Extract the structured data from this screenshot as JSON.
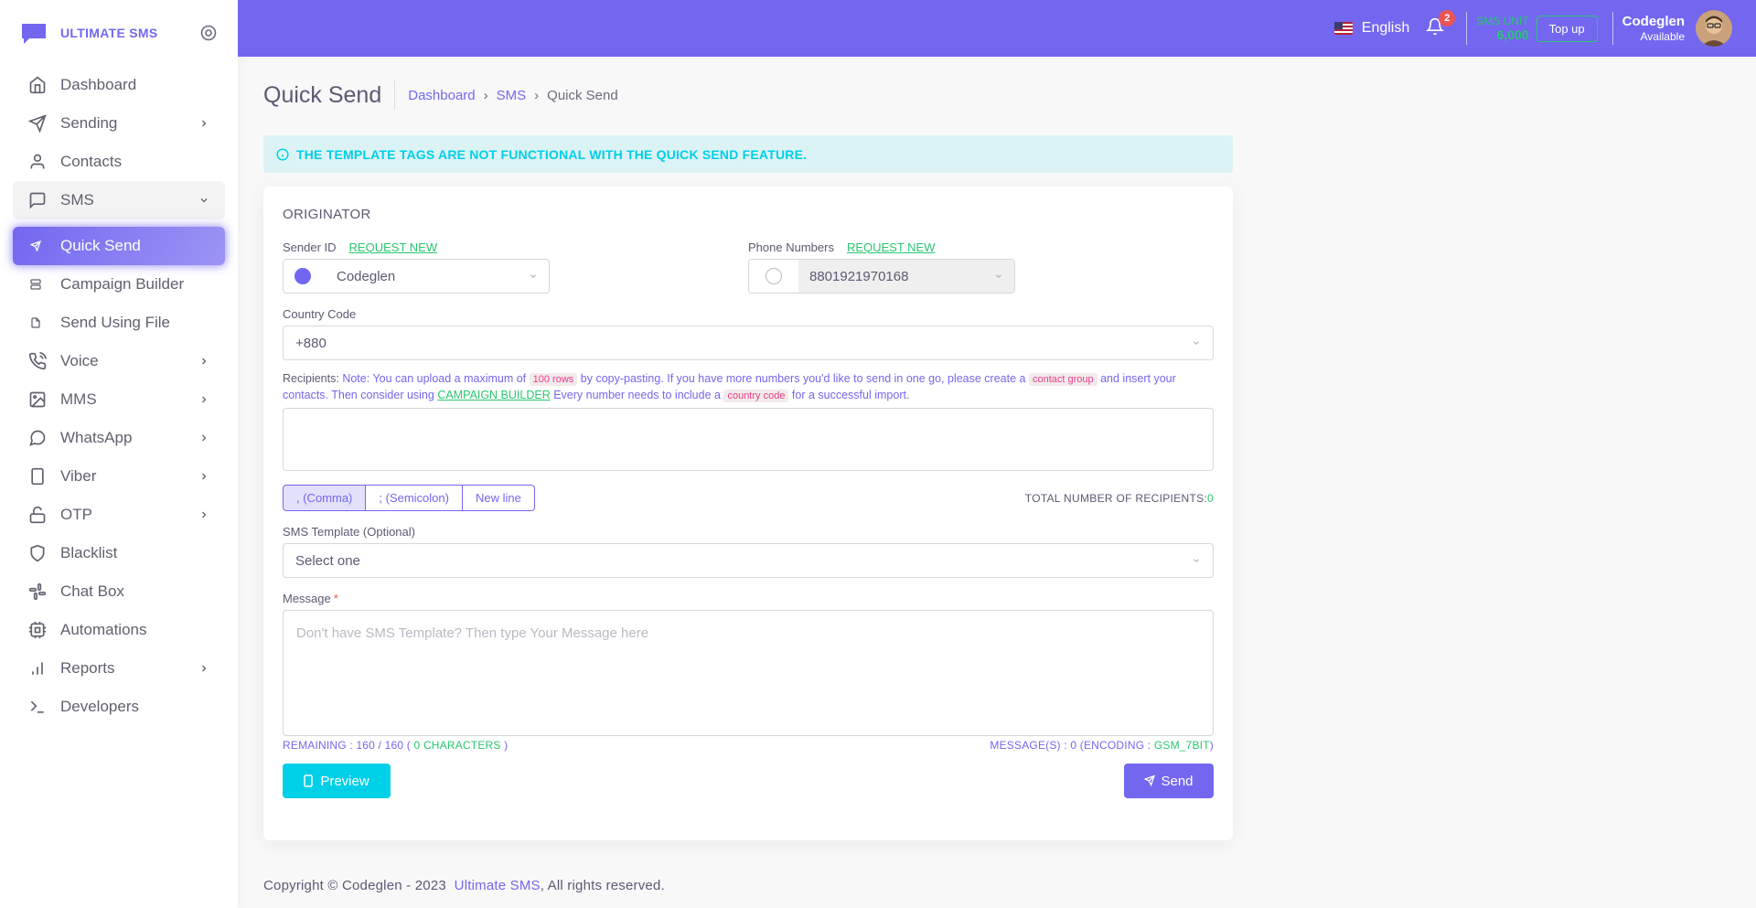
{
  "brand": {
    "name": "ULTIMATE SMS"
  },
  "sidebar": {
    "items": [
      {
        "label": "Dashboard",
        "icon": "home-icon"
      },
      {
        "label": "Sending",
        "icon": "send-icon",
        "has_children": true
      },
      {
        "label": "Contacts",
        "icon": "user-icon"
      },
      {
        "label": "SMS",
        "icon": "message-square-icon",
        "expanded": true
      },
      {
        "label": "Quick Send",
        "icon": "send-small-icon",
        "active": true
      },
      {
        "label": "Campaign Builder",
        "icon": "server-icon"
      },
      {
        "label": "Send Using File",
        "icon": "file-icon"
      },
      {
        "label": "Voice",
        "icon": "phone-call-icon",
        "has_children": true
      },
      {
        "label": "MMS",
        "icon": "image-icon",
        "has_children": true
      },
      {
        "label": "WhatsApp",
        "icon": "message-circle-icon",
        "has_children": true
      },
      {
        "label": "Viber",
        "icon": "smartphone-icon",
        "has_children": true
      },
      {
        "label": "OTP",
        "icon": "unlock-icon",
        "has_children": true
      },
      {
        "label": "Blacklist",
        "icon": "shield-icon"
      },
      {
        "label": "Chat Box",
        "icon": "slack-icon"
      },
      {
        "label": "Automations",
        "icon": "cpu-icon"
      },
      {
        "label": "Reports",
        "icon": "bar-chart-icon",
        "has_children": true
      },
      {
        "label": "Developers",
        "icon": "terminal-icon"
      }
    ]
  },
  "header": {
    "language": "English",
    "notification_count": "2",
    "sms_unit_label": "SMS UNIT",
    "sms_unit_value": "6,000",
    "topup_label": "Top up",
    "user_name": "Codeglen",
    "user_status": "Available"
  },
  "page": {
    "title": "Quick Send",
    "breadcrumb": [
      "Dashboard",
      "SMS",
      "Quick Send"
    ],
    "alert": "THE TEMPLATE TAGS ARE NOT FUNCTIONAL WITH THE QUICK SEND FEATURE."
  },
  "form": {
    "section_title": "ORIGINATOR",
    "sender_id_label": "Sender ID",
    "request_new": "REQUEST NEW",
    "sender_id_value": "Codeglen",
    "phone_numbers_label": "Phone Numbers",
    "phone_number_value": "8801921970168",
    "country_code_label": "Country Code",
    "country_code_value": "+880",
    "recipients_label": "Recipients:",
    "note_1": "Note: You can upload a maximum of",
    "note_rows": "100 rows",
    "note_2": "by copy-pasting. If you have more numbers you'd like to send in one go, please create a",
    "note_group": "contact group",
    "note_3": "and insert your contacts. Then consider using",
    "note_link": "CAMPAIGN BUILDER",
    "note_4": "Every number needs to include a",
    "note_cc": "country code",
    "note_5": "for a successful import.",
    "delimiters": [
      ", (Comma)",
      "; (Semicolon)",
      "New line"
    ],
    "total_recipients_label": "TOTAL NUMBER OF RECIPIENTS:",
    "total_recipients_value": "0",
    "template_label": "SMS Template (Optional)",
    "template_value": "Select one",
    "message_label": "Message",
    "required_mark": "*",
    "message_placeholder": "Don't have SMS Template? Then type Your Message here",
    "remaining_1": "REMAINING : 160 / 160 (",
    "remaining_chars": "0 CHARACTERS",
    "remaining_2": ")",
    "messages_1": "MESSAGE(S) : 0 (ENCODING :",
    "messages_enc": "GSM_7BIT",
    "messages_2": ")",
    "preview_label": "Preview",
    "send_label": "Send"
  },
  "footer": {
    "text_1": "Copyright © Codeglen - 2023",
    "link": "Ultimate SMS",
    "text_2": ", All rights reserved."
  },
  "colors": {
    "primary": "#7367f0",
    "success": "#28c76f",
    "info": "#00cfe8",
    "danger": "#ea5455"
  }
}
